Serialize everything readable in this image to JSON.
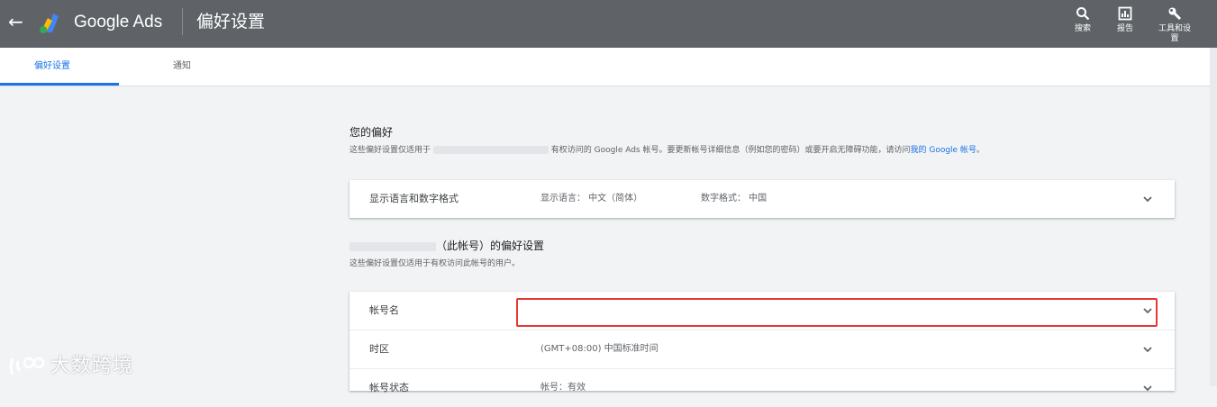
{
  "header": {
    "brand": "Google Ads",
    "page_title": "偏好设置",
    "tools": [
      {
        "label": "搜索",
        "icon": "search-icon"
      },
      {
        "label": "报告",
        "icon": "report-icon"
      },
      {
        "label": "工具和设置",
        "icon": "wrench-icon"
      }
    ]
  },
  "tabs": [
    {
      "label": "偏好设置",
      "active": true
    },
    {
      "label": "通知",
      "active": false
    }
  ],
  "your_prefs": {
    "title": "您的偏好",
    "desc_prefix": "这些偏好设置仅适用于",
    "desc_mid": "有权访问的 Google Ads 帐号。要更新帐号详细信息（例如您的密码）或要开启无障碍功能，请访问",
    "desc_link": "我的 Google 帐号",
    "desc_suffix": "。",
    "row": {
      "label": "显示语言和数字格式",
      "language": "显示语言： 中文（简体）",
      "number_format": "数字格式： 中国"
    }
  },
  "account_prefs": {
    "title_suffix": "（此帐号）的偏好设置",
    "desc": "这些偏好设置仅适用于有权访问此帐号的用户。",
    "rows": [
      {
        "label": "帐号名",
        "value": ""
      },
      {
        "label": "时区",
        "value": "(GMT+08:00) 中国标准时间"
      },
      {
        "label": "帐号状态",
        "value": "帐号：有效"
      }
    ]
  },
  "watermark": "大数跨境",
  "colors": {
    "topbar": "#5f6368",
    "accent": "#1a73e8",
    "highlight": "#e53935"
  }
}
